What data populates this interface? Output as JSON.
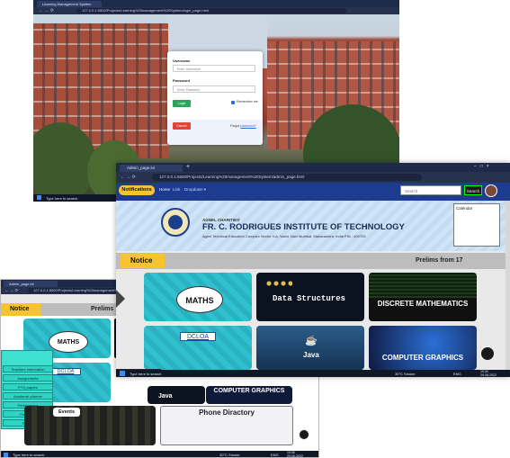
{
  "login_window": {
    "tab_title": "Learning Management System",
    "url": "127.0.0.1:5500/Projects/Learning%20management%20System/login_page.html",
    "username_label": "Username",
    "username_placeholder": "Enter Username",
    "password_label": "Password",
    "password_placeholder": "Enter Password",
    "login_button": "Login",
    "remember_label": "Remember me",
    "cancel_button": "Cancel",
    "forgot_text": "Forgot",
    "forgot_link": "password?",
    "taskbar_search": "Type here to search",
    "colors": {
      "login_green": "#2aa65a",
      "cancel_red": "#e0443a"
    }
  },
  "main_window": {
    "tab_title": "Admin_page.ini",
    "url": "127.0.0.1:5500/Projects/Learning%20management%20System/admin_page.html",
    "nav": {
      "notifications": "Notifications",
      "home": "Home",
      "link": "Link",
      "dropdown": "Dropdown",
      "search_placeholder": "Search",
      "search_button": "Search"
    },
    "banner": {
      "charity": "AGNEL CHARITIES'",
      "college": "FR. C. RODRIGUES INSTITUTE OF TECHNOLOGY",
      "address": "Agnel Technical Education Complex Sector 9-A, Vashi, Navi Mumbai, Maharashtra, India PIN - 400703",
      "calendar_label": "Calendar"
    },
    "notice_label": "Notice",
    "prelims_label": "Prelims from 17",
    "cards": [
      {
        "title": "MATHS"
      },
      {
        "title": "Data Structures"
      },
      {
        "title": "DISCRETE MATHEMATICS"
      },
      {
        "title": "DCLOA"
      },
      {
        "title": "Java"
      },
      {
        "title": "COMPUTER GRAPHICS"
      }
    ],
    "status_url": "https://www.google.com",
    "taskbar": {
      "search": "Type here to search",
      "weather": "30°C Smoke",
      "lang": "ENG",
      "time": "19:34",
      "date": "29-06-2022"
    }
  },
  "small_window": {
    "tab_title": "Admin_page.ini",
    "url": "127.0.0.1:5500/Projects/Learning%20management%20System/admin_page.html",
    "notice_label": "Notice",
    "prelims_label": "Prelims",
    "cards": [
      "MATHS",
      "DCLOA",
      "Java",
      "COMPUTER GRAPHICS"
    ],
    "sidebar_menu": [
      "Teachers information",
      "Assignments",
      "PYQ papers",
      "Academic planner",
      "Performance",
      "Feedback",
      "Report"
    ],
    "events_label": "Events",
    "phone_directory_label": "Phone Diractory",
    "taskbar": {
      "search": "Type here to search",
      "weather": "30°C Smoke",
      "lang": "ENG",
      "time": "19:36",
      "date": "29-06-2022"
    }
  }
}
